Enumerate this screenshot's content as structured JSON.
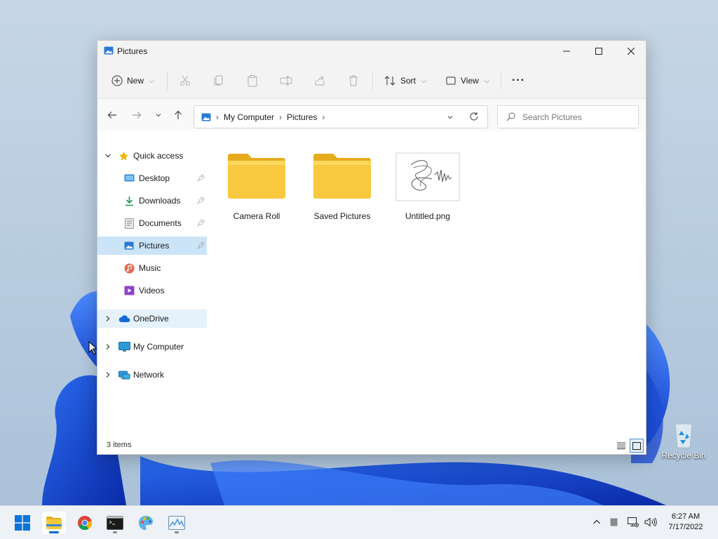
{
  "window": {
    "title": "Pictures",
    "toolbar": {
      "new_label": "New",
      "sort_label": "Sort",
      "view_label": "View",
      "more_label": "···"
    },
    "breadcrumb": [
      "My Computer",
      "Pictures"
    ],
    "search": {
      "placeholder": "Search Pictures"
    }
  },
  "sidebar": {
    "quick_access": "Quick access",
    "pinned": [
      {
        "label": "Desktop",
        "icon": "desktop-icon"
      },
      {
        "label": "Downloads",
        "icon": "download-icon"
      },
      {
        "label": "Documents",
        "icon": "document-icon"
      },
      {
        "label": "Pictures",
        "icon": "pictures-icon"
      }
    ],
    "unpinned": [
      {
        "label": "Music",
        "icon": "music-icon"
      },
      {
        "label": "Videos",
        "icon": "video-icon"
      }
    ],
    "onedrive": "OneDrive",
    "my_computer": "My Computer",
    "network": "Network"
  },
  "files": [
    {
      "name": "Camera Roll",
      "type": "folder"
    },
    {
      "name": "Saved Pictures",
      "type": "folder"
    },
    {
      "name": "Untitled.png",
      "type": "image"
    }
  ],
  "status": {
    "item_count": "3 items"
  },
  "desktop": {
    "recycle_bin": "Recycle Bin"
  },
  "taskbar": {
    "time": "6:27 AM",
    "date": "7/17/2022"
  },
  "colors": {
    "accent": "#0067c0",
    "selection": "#cce4f7",
    "folder": "#f8c93e"
  }
}
